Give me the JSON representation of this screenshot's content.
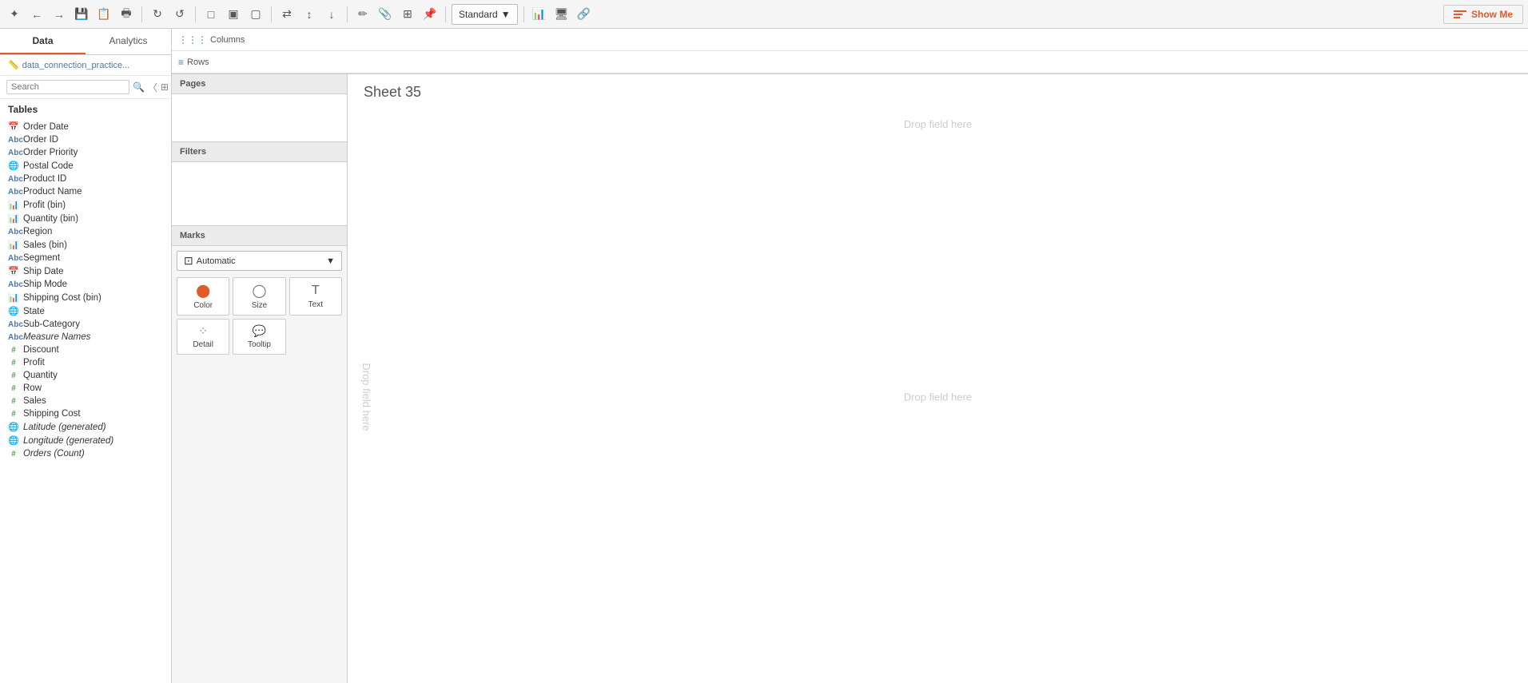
{
  "toolbar": {
    "show_me_label": "Show Me",
    "view_label": "Standard",
    "marks_automatic": "Automatic"
  },
  "sidebar": {
    "tab_data": "Data",
    "tab_analytics": "Analytics",
    "data_source": "data_connection_practice...",
    "search_placeholder": "Search",
    "tables_header": "Tables",
    "fields": [
      {
        "icon": "date",
        "icon_type": "blue",
        "name": "Order Date"
      },
      {
        "icon": "Abc",
        "icon_type": "blue",
        "name": "Order ID"
      },
      {
        "icon": "Abc",
        "icon_type": "blue",
        "name": "Order Priority"
      },
      {
        "icon": "globe",
        "icon_type": "globe",
        "name": "Postal Code"
      },
      {
        "icon": "Abc",
        "icon_type": "blue",
        "name": "Product ID"
      },
      {
        "icon": "Abc",
        "icon_type": "blue",
        "name": "Product Name"
      },
      {
        "icon": "bar",
        "icon_type": "green",
        "name": "Profit (bin)"
      },
      {
        "icon": "bar",
        "icon_type": "green",
        "name": "Quantity (bin)"
      },
      {
        "icon": "Abc",
        "icon_type": "blue",
        "name": "Region"
      },
      {
        "icon": "bar",
        "icon_type": "green",
        "name": "Sales (bin)"
      },
      {
        "icon": "Abc",
        "icon_type": "blue",
        "name": "Segment"
      },
      {
        "icon": "date",
        "icon_type": "blue",
        "name": "Ship Date"
      },
      {
        "icon": "Abc",
        "icon_type": "blue",
        "name": "Ship Mode"
      },
      {
        "icon": "bar",
        "icon_type": "green",
        "name": "Shipping Cost (bin)"
      },
      {
        "icon": "globe",
        "icon_type": "globe",
        "name": "State"
      },
      {
        "icon": "Abc",
        "icon_type": "blue",
        "name": "Sub-Category"
      },
      {
        "icon": "Abc",
        "icon_type": "blue",
        "name": "Measure Names",
        "italic": true
      },
      {
        "icon": "#",
        "icon_type": "green",
        "name": "Discount"
      },
      {
        "icon": "#",
        "icon_type": "green",
        "name": "Profit"
      },
      {
        "icon": "#",
        "icon_type": "green",
        "name": "Quantity"
      },
      {
        "icon": "#",
        "icon_type": "green",
        "name": "Row"
      },
      {
        "icon": "#",
        "icon_type": "green",
        "name": "Sales"
      },
      {
        "icon": "#",
        "icon_type": "green",
        "name": "Shipping Cost"
      },
      {
        "icon": "globe",
        "icon_type": "globe",
        "name": "Latitude (generated)",
        "italic": true
      },
      {
        "icon": "globe",
        "icon_type": "globe",
        "name": "Longitude (generated)",
        "italic": true
      },
      {
        "icon": "#",
        "icon_type": "green",
        "name": "Orders (Count)",
        "italic": true
      }
    ]
  },
  "panels": {
    "filters_label": "Filters",
    "marks_label": "Marks",
    "marks_type": "Automatic",
    "color_label": "Color",
    "size_label": "Size",
    "text_label": "Text",
    "detail_label": "Detail",
    "tooltip_label": "Tooltip"
  },
  "canvas": {
    "sheet_title": "Sheet 35",
    "columns_label": "Columns",
    "rows_label": "Rows",
    "drop_hint_top": "Drop field here",
    "drop_hint_center": "Drop field here",
    "drop_hint_left": "Drop field here",
    "pages_label": "Pages"
  }
}
